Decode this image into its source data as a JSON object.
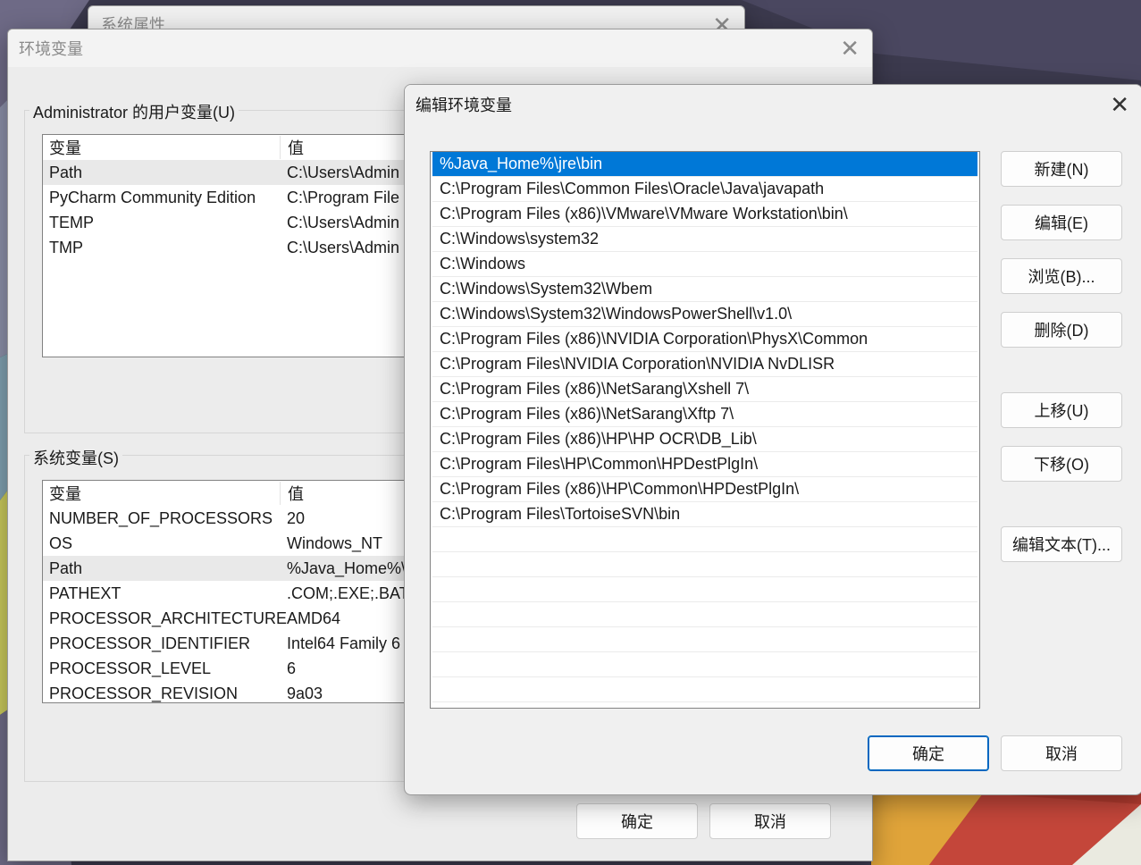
{
  "system_properties_window": {
    "title": "系统属性"
  },
  "env_window": {
    "title": "环境变量",
    "user_vars": {
      "label": "Administrator 的用户变量(U)",
      "col_name": "变量",
      "col_value": "值",
      "rows": [
        {
          "name": "Path",
          "value": "C:\\Users\\Admin"
        },
        {
          "name": "PyCharm Community Edition",
          "value": "C:\\Program File"
        },
        {
          "name": "TEMP",
          "value": "C:\\Users\\Admin"
        },
        {
          "name": "TMP",
          "value": "C:\\Users\\Admin"
        }
      ]
    },
    "system_vars": {
      "label": "系统变量(S)",
      "col_name": "变量",
      "col_value": "值",
      "rows": [
        {
          "name": "NUMBER_OF_PROCESSORS",
          "value": "20"
        },
        {
          "name": "OS",
          "value": "Windows_NT"
        },
        {
          "name": "Path",
          "value": "%Java_Home%\\"
        },
        {
          "name": "PATHEXT",
          "value": ".COM;.EXE;.BAT;"
        },
        {
          "name": "PROCESSOR_ARCHITECTURE",
          "value": "AMD64"
        },
        {
          "name": "PROCESSOR_IDENTIFIER",
          "value": "Intel64 Family 6"
        },
        {
          "name": "PROCESSOR_LEVEL",
          "value": "6"
        },
        {
          "name": "PROCESSOR_REVISION",
          "value": "9a03"
        }
      ]
    },
    "ok_label": "确定",
    "cancel_label": "取消"
  },
  "edit_window": {
    "title": "编辑环境变量",
    "paths": [
      "%Java_Home%\\jre\\bin",
      "C:\\Program Files\\Common Files\\Oracle\\Java\\javapath",
      "C:\\Program Files (x86)\\VMware\\VMware Workstation\\bin\\",
      "C:\\Windows\\system32",
      "C:\\Windows",
      "C:\\Windows\\System32\\Wbem",
      "C:\\Windows\\System32\\WindowsPowerShell\\v1.0\\",
      "C:\\Program Files (x86)\\NVIDIA Corporation\\PhysX\\Common",
      "C:\\Program Files\\NVIDIA Corporation\\NVIDIA NvDLISR",
      "C:\\Program Files (x86)\\NetSarang\\Xshell 7\\",
      "C:\\Program Files (x86)\\NetSarang\\Xftp 7\\",
      "C:\\Program Files (x86)\\HP\\HP OCR\\DB_Lib\\",
      "C:\\Program Files\\HP\\Common\\HPDestPlgIn\\",
      "C:\\Program Files (x86)\\HP\\Common\\HPDestPlgIn\\",
      "C:\\Program Files\\TortoiseSVN\\bin"
    ],
    "buttons": {
      "new": "新建(N)",
      "edit": "编辑(E)",
      "browse": "浏览(B)...",
      "delete": "删除(D)",
      "move_up": "上移(U)",
      "move_down": "下移(O)",
      "edit_text": "编辑文本(T)..."
    },
    "ok_label": "确定",
    "cancel_label": "取消"
  }
}
